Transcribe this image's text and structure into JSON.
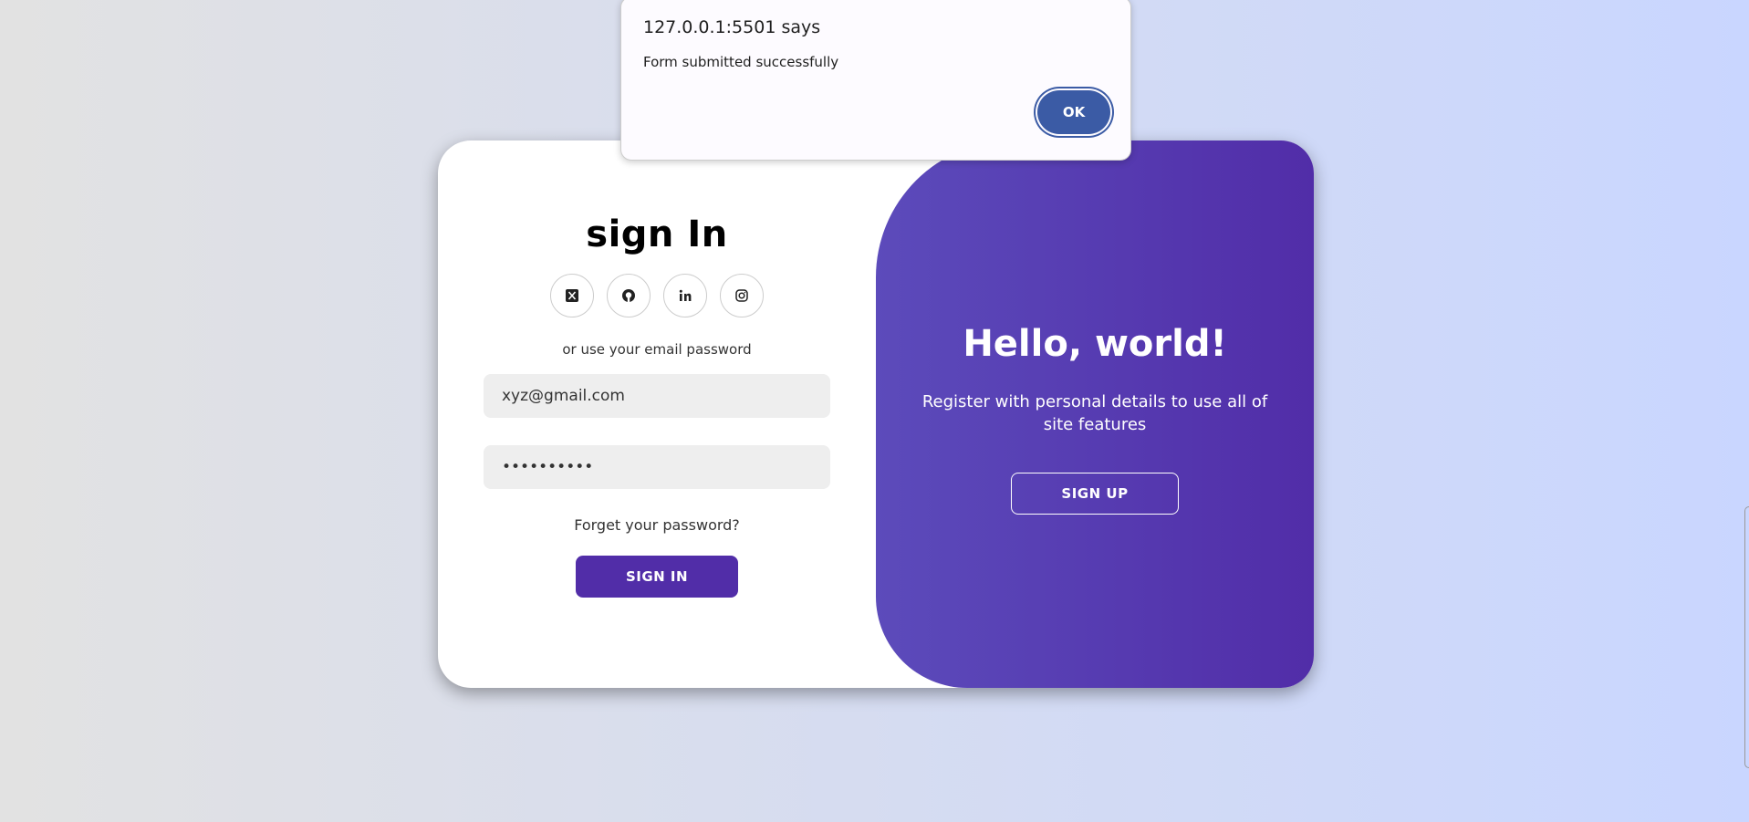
{
  "dialog": {
    "origin": "127.0.0.1:5501 says",
    "message": "Form submitted successfully",
    "ok_label": "OK"
  },
  "signin": {
    "title": "sign In",
    "social_icons": [
      "x-icon",
      "github-icon",
      "linkedin-icon",
      "instagram-icon"
    ],
    "hint": "or use your email password",
    "email_value": "xyz@gmail.com",
    "password_value": "••••••••••",
    "forgot_label": "Forget your password?",
    "button_label": "SIGN IN"
  },
  "panel": {
    "heading": "Hello, world!",
    "text": "Register with personal details to use all of site features",
    "button_label": "SIGN UP"
  },
  "colors": {
    "accent": "#512da8",
    "dialog_ok": "#3b5ba5"
  }
}
